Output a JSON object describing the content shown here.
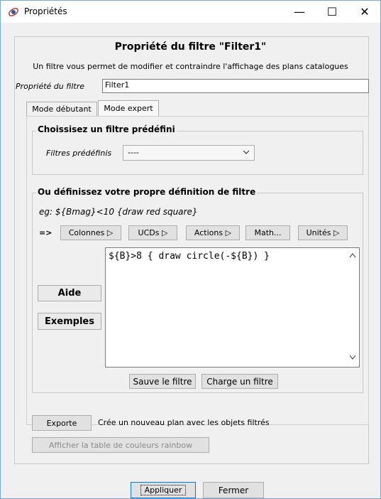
{
  "window": {
    "title": "Propriétés"
  },
  "titlebar": {
    "minimize": "—",
    "maximize": "☐",
    "close": "✕"
  },
  "dialog": {
    "heading": "Propriété du filtre \"Filter1\"",
    "description": "Un filtre vous permet de modifier et contraindre l'affichage des plans catalogues",
    "name_label": "Propriété du filtre",
    "name_value": "Filter1"
  },
  "tabs": [
    {
      "label": "Mode débutant"
    },
    {
      "label": "Mode expert"
    }
  ],
  "predefined": {
    "group_title": "Choissisez un filtre prédéfini",
    "label": "Filtres prédéfinis",
    "selected": "----"
  },
  "custom": {
    "group_title": "Ou définissez votre propre définition de filtre",
    "example": "eg: ${Bmag}<10 {draw red square}",
    "arrow": "=>",
    "menus": [
      {
        "label": "Colonnes ▷"
      },
      {
        "label": "UCDs ▷"
      },
      {
        "label": "Actions ▷"
      },
      {
        "label": "Math..."
      },
      {
        "label": "Unités ▷"
      }
    ],
    "help_label": "Aide",
    "examples_label": "Exemples",
    "filter_text": "${B}>8 { draw circle(-${B}) }",
    "save_label": "Sauve le filtre",
    "load_label": "Charge un filtre"
  },
  "export": {
    "button_label": "Exporte",
    "description": "Crée un nouveau plan avec les objets filtrés",
    "colormap_label": "Afficher la table de couleurs rainbow"
  },
  "footer": {
    "apply_label": "Appliquer",
    "close_label": "Fermer"
  }
}
